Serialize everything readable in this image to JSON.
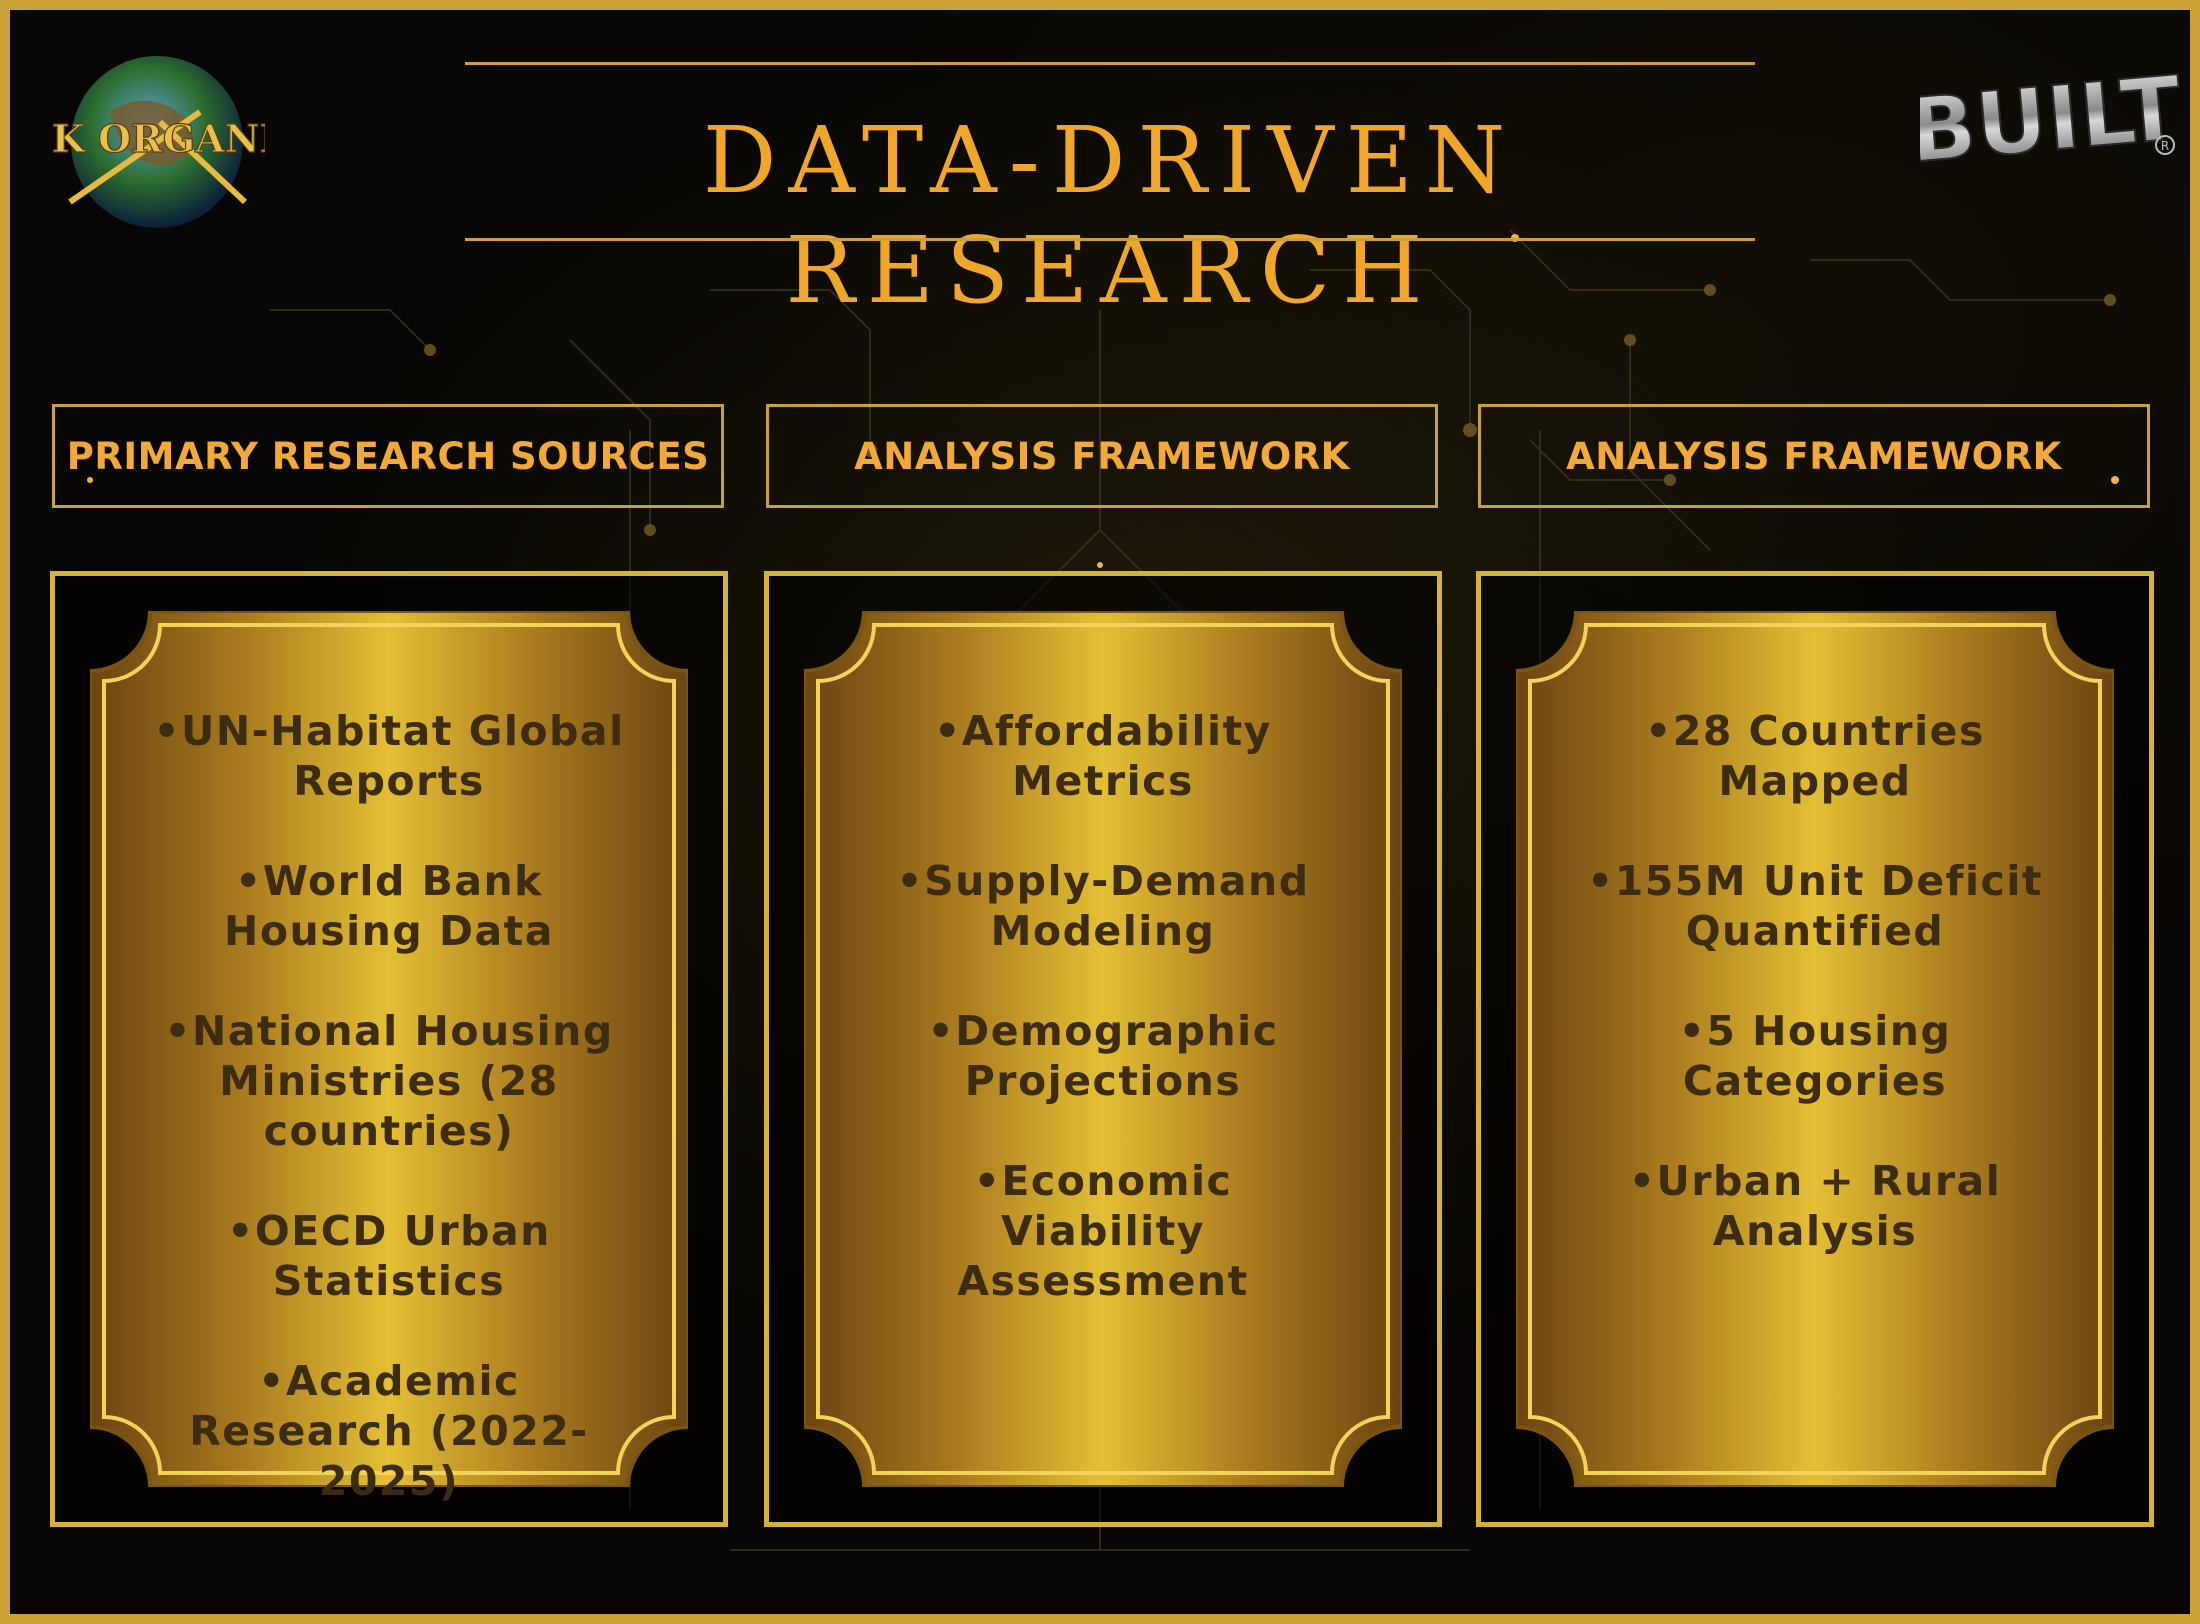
{
  "title": "DATA-DRIVEN RESEARCH",
  "logos": {
    "left": "JEMROCK ORGANIZATION",
    "right": "BUILT"
  },
  "colors": {
    "accent_gold": "#c9a134",
    "title_orange": "#f0a62b",
    "card_text": "#3b2c12"
  },
  "columns": [
    {
      "header": "PRIMARY RESEARCH SOURCES",
      "items": [
        "•UN-Habitat Global Reports",
        "•World Bank Housing Data",
        "•National Housing Ministries (28 countries)",
        "•OECD Urban Statistics",
        "•Academic Research (2022-2025)"
      ]
    },
    {
      "header": "ANALYSIS FRAMEWORK",
      "items": [
        "•Affordability Metrics",
        "•Supply-Demand Modeling",
        "•Demographic Projections",
        "•Economic Viability Assessment"
      ]
    },
    {
      "header": "ANALYSIS FRAMEWORK",
      "items": [
        "•28 Countries Mapped",
        "•155M Unit Deficit Quantified",
        "•5 Housing Categories",
        "•Urban + Rural Analysis"
      ]
    }
  ]
}
